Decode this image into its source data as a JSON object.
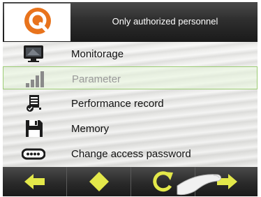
{
  "header": {
    "title": "Only authorized personnel",
    "logo_icon": "q-logo-icon"
  },
  "menu": {
    "items": [
      {
        "label": "Monitorage",
        "icon": "monitor-icon"
      },
      {
        "label": "Parameter",
        "icon": "signal-bars-icon",
        "selected": true
      },
      {
        "label": "Performance record",
        "icon": "report-icon"
      },
      {
        "label": "Memory",
        "icon": "floppy-disk-icon"
      },
      {
        "label": "Change access password",
        "icon": "password-field-icon"
      }
    ]
  },
  "toolbar": {
    "buttons": [
      {
        "name": "back-button",
        "icon": "arrow-left-icon"
      },
      {
        "name": "home-button",
        "icon": "diamond-icon"
      },
      {
        "name": "refresh-button",
        "icon": "refresh-icon"
      },
      {
        "name": "forward-button",
        "icon": "arrow-right-icon"
      }
    ]
  },
  "colors": {
    "accent": "#e8731c",
    "toolbar_icon": "#e3e84a",
    "selected_border": "#9ccc74"
  }
}
